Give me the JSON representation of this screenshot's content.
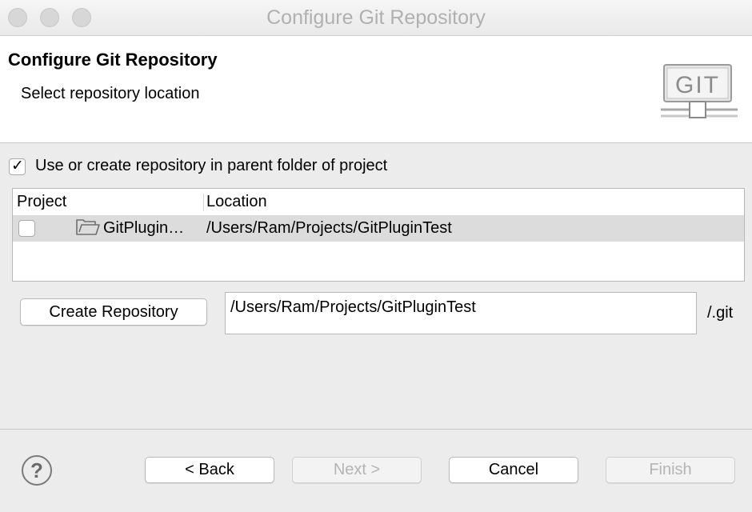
{
  "window": {
    "title": "Configure Git Repository"
  },
  "banner": {
    "title": "Configure Git Repository",
    "subtitle": "Select repository location",
    "logo_text": "GIT"
  },
  "options": {
    "use_parent_label": "Use or create repository in parent folder of project",
    "use_parent_checked": true
  },
  "table": {
    "columns": [
      "Project",
      "Location"
    ],
    "rows": [
      {
        "project": "GitPlugin…",
        "location": "/Users/Ram/Projects/GitPluginTest",
        "checked": false,
        "icon": "folder-icon"
      }
    ]
  },
  "create": {
    "button_label": "Create Repository",
    "path_value": "/Users/Ram/Projects/GitPluginTest",
    "suffix": "/.git"
  },
  "footer": {
    "help_label": "?",
    "back_label": "< Back",
    "next_label": "Next >",
    "cancel_label": "Cancel",
    "finish_label": "Finish"
  }
}
